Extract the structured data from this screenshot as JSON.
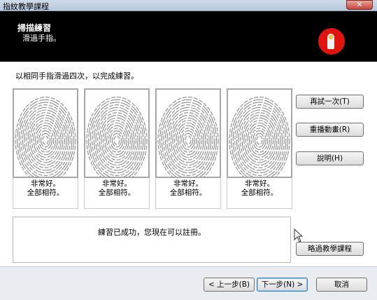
{
  "window": {
    "title": "指紋教學課程",
    "close_label": "✕"
  },
  "header": {
    "title": "掃描練習",
    "subtitle": "滑過手指。",
    "icon": "fingerprint-app-icon"
  },
  "main": {
    "instruction": "以相同手指滑過四次，以完成練習。",
    "slots": [
      {
        "line1": "非常好。",
        "line2": "全部相符。"
      },
      {
        "line1": "非常好。",
        "line2": "全部相符。"
      },
      {
        "line1": "非常好。",
        "line2": "全部相符。"
      },
      {
        "line1": "非常好。",
        "line2": "全部相符。"
      }
    ],
    "status": "練習已成功，您現在可以註冊。"
  },
  "side_buttons": {
    "retry": "再試一次(T)",
    "replay": "重播動畫(R)",
    "help": "說明(H)",
    "skip": "略過教學課程"
  },
  "footer": {
    "back": "< 上一步(B)",
    "next": "下一步(N) >",
    "cancel": "取消"
  },
  "colors": {
    "header_bg": "#000000",
    "icon_red": "#e0140f",
    "title_bar": "#c4d3e5"
  }
}
